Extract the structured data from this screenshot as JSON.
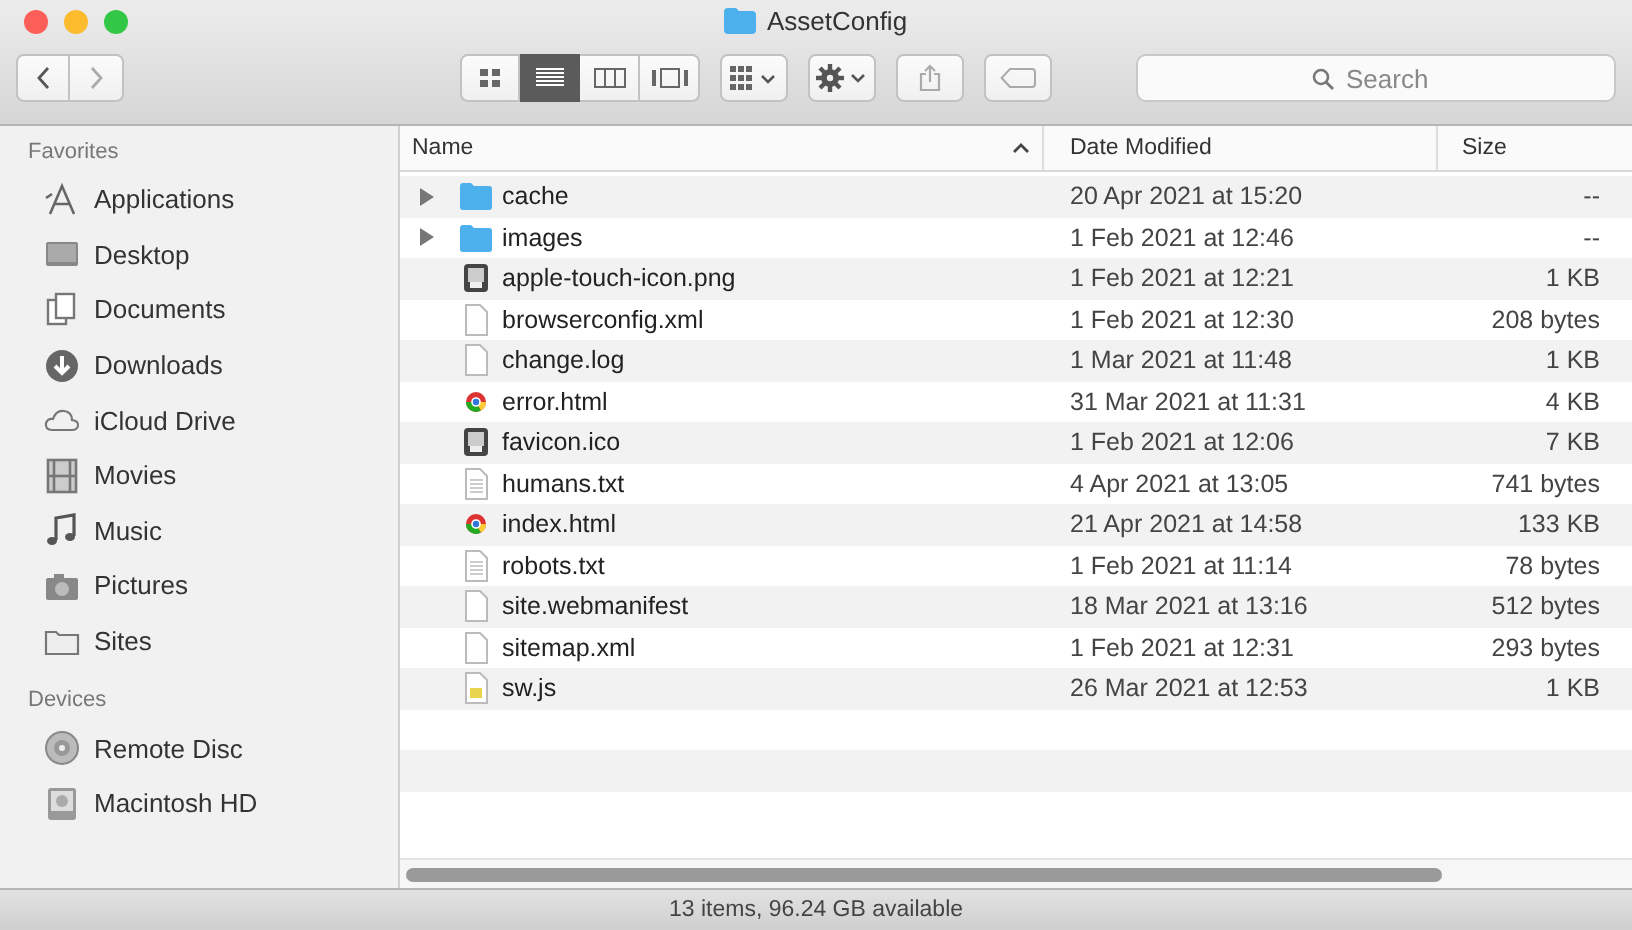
{
  "window": {
    "title": "AssetConfig"
  },
  "toolbar": {
    "views": [
      {
        "kind": "icons",
        "selected": false
      },
      {
        "kind": "list",
        "selected": true
      },
      {
        "kind": "columns",
        "selected": false
      },
      {
        "kind": "gallery",
        "selected": false
      }
    ],
    "search": {
      "placeholder": "Search"
    }
  },
  "sidebar": {
    "sections": [
      {
        "title": "Favorites",
        "items": [
          {
            "label": "Applications",
            "kind": "apps"
          },
          {
            "label": "Desktop",
            "kind": "desktop"
          },
          {
            "label": "Documents",
            "kind": "documents"
          },
          {
            "label": "Downloads",
            "kind": "downloads"
          },
          {
            "label": "iCloud Drive",
            "kind": "cloud"
          },
          {
            "label": "Movies",
            "kind": "movies"
          },
          {
            "label": "Music",
            "kind": "music"
          },
          {
            "label": "Pictures",
            "kind": "pictures"
          },
          {
            "label": "Sites",
            "kind": "folder"
          }
        ]
      },
      {
        "title": "Devices",
        "items": [
          {
            "label": "Remote Disc",
            "kind": "disc"
          },
          {
            "label": "Macintosh HD",
            "kind": "disk"
          }
        ]
      }
    ]
  },
  "table": {
    "columns": [
      {
        "label": "Name",
        "sorted": true
      },
      {
        "label": "Date Modified",
        "sorted": false
      },
      {
        "label": "Size",
        "sorted": false
      }
    ],
    "rows": [
      {
        "name": "cache",
        "kind": "folder",
        "expanded": false,
        "date": "20 Apr 2021 at 15:20",
        "size": "--"
      },
      {
        "name": "images",
        "kind": "folder",
        "expanded": false,
        "date": "1 Feb 2021 at 12:46",
        "size": "--"
      },
      {
        "name": "apple-touch-icon.png",
        "kind": "image",
        "date": "1 Feb 2021 at 12:21",
        "size": "1 KB"
      },
      {
        "name": "browserconfig.xml",
        "kind": "doc",
        "date": "1 Feb 2021 at 12:30",
        "size": "208 bytes"
      },
      {
        "name": "change.log",
        "kind": "doc",
        "date": "1 Mar 2021 at 11:48",
        "size": "1 KB"
      },
      {
        "name": "error.html",
        "kind": "web",
        "date": "31 Mar 2021 at 11:31",
        "size": "4 KB"
      },
      {
        "name": "favicon.ico",
        "kind": "image",
        "date": "1 Feb 2021 at 12:06",
        "size": "7 KB"
      },
      {
        "name": "humans.txt",
        "kind": "text",
        "date": "4 Apr 2021 at 13:05",
        "size": "741 bytes"
      },
      {
        "name": "index.html",
        "kind": "web",
        "date": "21 Apr 2021 at 14:58",
        "size": "133 KB"
      },
      {
        "name": "robots.txt",
        "kind": "text",
        "date": "1 Feb 2021 at 11:14",
        "size": "78 bytes"
      },
      {
        "name": "site.webmanifest",
        "kind": "doc",
        "date": "18 Mar 2021 at 13:16",
        "size": "512 bytes"
      },
      {
        "name": "sitemap.xml",
        "kind": "doc",
        "date": "1 Feb 2021 at 12:31",
        "size": "293 bytes"
      },
      {
        "name": "sw.js",
        "kind": "js",
        "date": "26 Mar 2021 at 12:53",
        "size": "1 KB"
      }
    ]
  },
  "status_bar": "13 items, 96.24 GB available"
}
